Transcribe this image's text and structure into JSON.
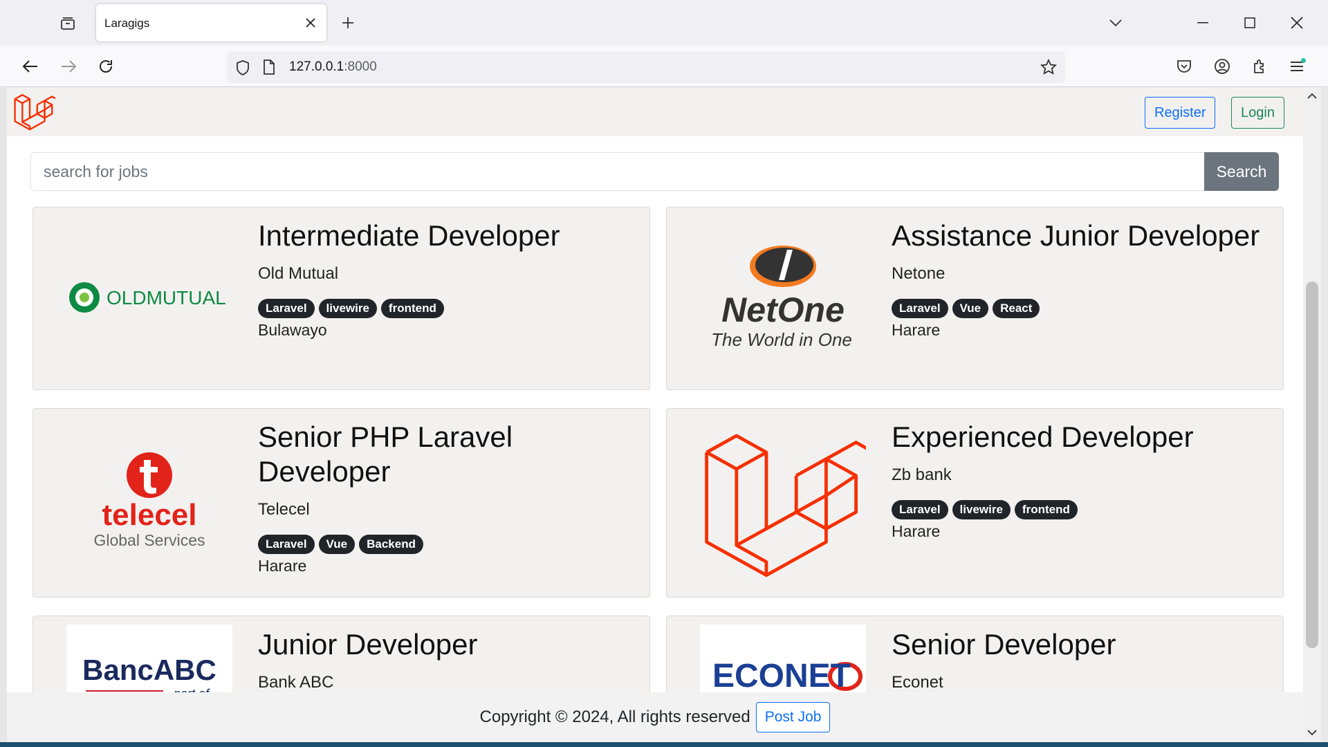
{
  "browser": {
    "tab_title": "Laragigs",
    "url_host": "127.0.0.1",
    "url_port": ":8000"
  },
  "header": {
    "register_label": "Register",
    "login_label": "Login"
  },
  "search": {
    "placeholder": "search for jobs",
    "button_label": "Search"
  },
  "jobs": [
    {
      "title": "Intermediate Developer",
      "company": "Old Mutual",
      "tags": [
        "Laravel",
        "livewire",
        "frontend"
      ],
      "location": "Bulawayo",
      "logo": "OLDMUTUAL"
    },
    {
      "title": "Assistance Junior Developer",
      "company": "Netone",
      "tags": [
        "Laravel",
        "Vue",
        "React"
      ],
      "location": "Harare",
      "logo": "NetOne",
      "logo_tagline": "The World in One"
    },
    {
      "title": "Senior PHP Laravel Developer",
      "company": "Telecel",
      "tags": [
        "Laravel",
        "Vue",
        "Backend"
      ],
      "location": "Harare",
      "logo": "telecel",
      "logo_tagline": "Global Services"
    },
    {
      "title": "Experienced Developer",
      "company": "Zb bank",
      "tags": [
        "Laravel",
        "livewire",
        "frontend"
      ],
      "location": "Harare",
      "logo": "laravel-logo"
    },
    {
      "title": "Junior Developer",
      "company": "Bank ABC",
      "tags": [],
      "location": "",
      "logo": "BancABC",
      "logo_tagline": "part of"
    },
    {
      "title": "Senior Developer",
      "company": "Econet",
      "tags": [],
      "location": "",
      "logo": "ECONET"
    }
  ],
  "footer": {
    "copyright": "Copyright © 2024, All rights reserved",
    "post_job_label": "Post Job"
  },
  "colors": {
    "laravel_red": "#f53003",
    "primary": "#0d6efd",
    "success": "#198754",
    "secondary": "#6c757d"
  }
}
